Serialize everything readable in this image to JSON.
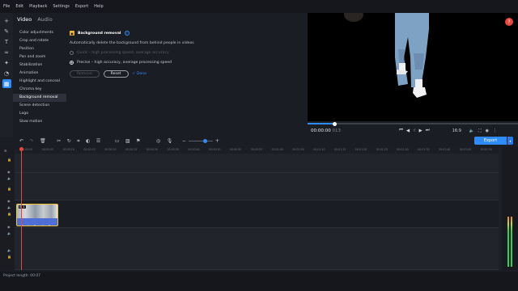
{
  "menu": [
    "File",
    "Edit",
    "Playback",
    "Settings",
    "Export",
    "Help"
  ],
  "tabs": [
    {
      "label": "Video",
      "active": true
    },
    {
      "label": "Audio",
      "active": false
    }
  ],
  "tool_icons": [
    "add-icon",
    "magic-wand-icon",
    "text-icon",
    "transition-icon",
    "sticker-icon",
    "timer-icon",
    "more-tools-icon"
  ],
  "features": [
    "Color adjustments",
    "Crop and rotate",
    "Position",
    "Pan and zoom",
    "Stabilization",
    "Animation",
    "Highlight and conceal",
    "Chroma key",
    "Background removal",
    "Scene detection",
    "Logo",
    "Slow motion"
  ],
  "active_feature": "Background removal",
  "panel": {
    "title": "Background removal",
    "description": "Automatically delete the background from behind people in videos",
    "option_quick": "Quick – high processing speed, average accuracy",
    "option_precise": "Precise – high accuracy, average processing speed",
    "selected_option": "precise",
    "remove_label": "Remove",
    "reset_label": "Reset",
    "done_label": "Done"
  },
  "player": {
    "time_main": "00:00:00",
    "time_ms": "013",
    "progress": 0.13,
    "ratio": "16:9",
    "close_label": "?"
  },
  "export_label": "Export",
  "ruler_ticks": [
    "00:00:00",
    "00:00:05",
    "00:00:10",
    "00:00:15",
    "00:00:20",
    "00:00:25",
    "00:00:30",
    "00:00:35",
    "00:00:40",
    "00:00:45",
    "00:00:50",
    "00:00:55",
    "00:01:00",
    "00:01:05",
    "00:01:10",
    "00:01:15",
    "00:01:20",
    "00:01:25",
    "00:01:30",
    "00:01:35",
    "00:01:40",
    "00:01:45",
    "00:01:50",
    "00:01:55"
  ],
  "clip_badge": "1",
  "status": "Project length: 00:07",
  "colors": {
    "accent": "#2f8cff",
    "clip_border": "#f2c12e",
    "playhead": "#e7473c"
  }
}
